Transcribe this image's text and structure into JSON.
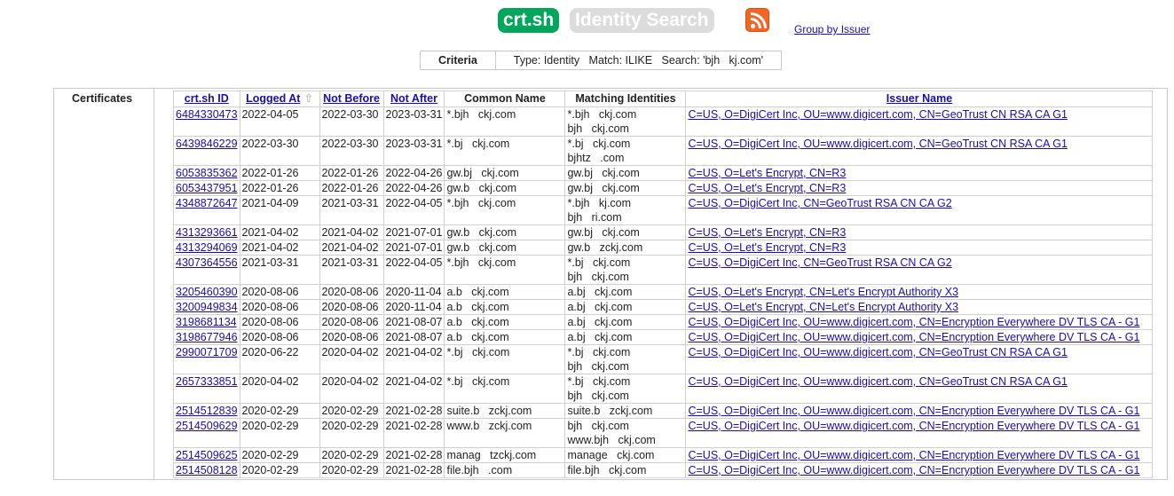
{
  "header": {
    "brand": "crt.sh",
    "title": "Identity Search",
    "group_link": "Group by Issuer"
  },
  "criteria": {
    "label": "Criteria",
    "text": "Type: Identity   Match: ILIKE   Search: 'bjh   kj.com'"
  },
  "section_label": "Certificates",
  "columns": {
    "id": "crt.sh ID",
    "logged": "Logged At",
    "sort_arrow": "⇧",
    "not_before": "Not Before",
    "not_after": "Not After",
    "common_name": "Common Name",
    "matching": "Matching Identities",
    "issuer": "Issuer Name"
  },
  "rows": [
    {
      "id": "6484330473",
      "logged": "2022-04-05",
      "not_before": "2022-03-30",
      "not_after": "2023-03-31",
      "cn": "*.bjh   ckj.com",
      "match": [
        "*.bjh   ckj.com",
        "bjh   ckj.com"
      ],
      "issuer": "C=US, O=DigiCert Inc, OU=www.digicert.com, CN=GeoTrust CN RSA CA G1"
    },
    {
      "id": "6439846229",
      "logged": "2022-03-30",
      "not_before": "2022-03-30",
      "not_after": "2023-03-31",
      "cn": "*.bj   ckj.com",
      "match": [
        "*.bj   ckj.com",
        "bjhtz   .com"
      ],
      "issuer": "C=US, O=DigiCert Inc, OU=www.digicert.com, CN=GeoTrust CN RSA CA G1"
    },
    {
      "id": "6053835362",
      "logged": "2022-01-26",
      "not_before": "2022-01-26",
      "not_after": "2022-04-26",
      "cn": "gw.bj   ckj.com",
      "match": [
        "gw.bj   ckj.com"
      ],
      "issuer": "C=US, O=Let's Encrypt, CN=R3"
    },
    {
      "id": "6053437951",
      "logged": "2022-01-26",
      "not_before": "2022-01-26",
      "not_after": "2022-04-26",
      "cn": "gw.b   ckj.com",
      "match": [
        "gw.bj   ckj.com"
      ],
      "issuer": "C=US, O=Let's Encrypt, CN=R3"
    },
    {
      "id": "4348872647",
      "logged": "2021-04-09",
      "not_before": "2021-03-31",
      "not_after": "2022-04-05",
      "cn": "*.bjh   ckj.com",
      "match": [
        "*.bjh   kj.com",
        "bjh   ri.com"
      ],
      "issuer": "C=US, O=DigiCert Inc, CN=GeoTrust RSA CN CA G2"
    },
    {
      "id": "4313293661",
      "logged": "2021-04-02",
      "not_before": "2021-04-02",
      "not_after": "2021-07-01",
      "cn": "gw.b   ckj.com",
      "match": [
        "gw.bj   ckj.com"
      ],
      "issuer": "C=US, O=Let's Encrypt, CN=R3"
    },
    {
      "id": "4313294069",
      "logged": "2021-04-02",
      "not_before": "2021-04-02",
      "not_after": "2021-07-01",
      "cn": "gw.b   ckj.com",
      "match": [
        "gw.b   zckj.com"
      ],
      "issuer": "C=US, O=Let's Encrypt, CN=R3"
    },
    {
      "id": "4307364556",
      "logged": "2021-03-31",
      "not_before": "2021-03-31",
      "not_after": "2022-04-05",
      "cn": "*.bjh   ckj.com",
      "match": [
        "*.bj   ckj.com",
        "bjh   ckj.com"
      ],
      "issuer": "C=US, O=DigiCert Inc, CN=GeoTrust RSA CN CA G2"
    },
    {
      "id": "3205460390",
      "logged": "2020-08-06",
      "not_before": "2020-08-06",
      "not_after": "2020-11-04",
      "cn": "a.b   ckj.com",
      "match": [
        "a.bj   ckj.com"
      ],
      "issuer": "C=US, O=Let's Encrypt, CN=Let's Encrypt Authority X3"
    },
    {
      "id": "3200949834",
      "logged": "2020-08-06",
      "not_before": "2020-08-06",
      "not_after": "2020-11-04",
      "cn": "a.b   ckj.com",
      "match": [
        "a.bj   ckj.com"
      ],
      "issuer": "C=US, O=Let's Encrypt, CN=Let's Encrypt Authority X3"
    },
    {
      "id": "3198681134",
      "logged": "2020-08-06",
      "not_before": "2020-08-06",
      "not_after": "2021-08-07",
      "cn": "a.b   ckj.com",
      "match": [
        "a.bj   ckj.com"
      ],
      "issuer": "C=US, O=DigiCert Inc, OU=www.digicert.com, CN=Encryption Everywhere DV TLS CA - G1"
    },
    {
      "id": "3198677946",
      "logged": "2020-08-06",
      "not_before": "2020-08-06",
      "not_after": "2021-08-07",
      "cn": "a.b   ckj.com",
      "match": [
        "a.bj   ckj.com"
      ],
      "issuer": "C=US, O=DigiCert Inc, OU=www.digicert.com, CN=Encryption Everywhere DV TLS CA - G1"
    },
    {
      "id": "2990071709",
      "logged": "2020-06-22",
      "not_before": "2020-04-02",
      "not_after": "2021-04-02",
      "cn": "*.bj   ckj.com",
      "match": [
        "*.bj   ckj.com",
        "bjh   ckj.com"
      ],
      "issuer": "C=US, O=DigiCert Inc, OU=www.digicert.com, CN=GeoTrust CN RSA CA G1"
    },
    {
      "id": "2657333851",
      "logged": "2020-04-02",
      "not_before": "2020-04-02",
      "not_after": "2021-04-02",
      "cn": "*.bj   ckj.com",
      "match": [
        "*.bj   ckj.com",
        "bjh   ckj.com"
      ],
      "issuer": "C=US, O=DigiCert Inc, OU=www.digicert.com, CN=GeoTrust CN RSA CA G1"
    },
    {
      "id": "2514512839",
      "logged": "2020-02-29",
      "not_before": "2020-02-29",
      "not_after": "2021-02-28",
      "cn": "suite.b   zckj.com",
      "match": [
        "suite.b   zckj.com"
      ],
      "issuer": "C=US, O=DigiCert Inc, OU=www.digicert.com, CN=Encryption Everywhere DV TLS CA - G1"
    },
    {
      "id": "2514509629",
      "logged": "2020-02-29",
      "not_before": "2020-02-29",
      "not_after": "2021-02-28",
      "cn": "www.b   zckj.com",
      "match": [
        "bjh   ckj.com",
        "www.bjh   ckj.com"
      ],
      "issuer": "C=US, O=DigiCert Inc, OU=www.digicert.com, CN=Encryption Everywhere DV TLS CA - G1"
    },
    {
      "id": "2514509625",
      "logged": "2020-02-29",
      "not_before": "2020-02-29",
      "not_after": "2021-02-28",
      "cn": "manag   tzckj.com",
      "match": [
        "manage   ckj.com"
      ],
      "issuer": "C=US, O=DigiCert Inc, OU=www.digicert.com, CN=Encryption Everywhere DV TLS CA - G1"
    },
    {
      "id": "2514508128",
      "logged": "2020-02-29",
      "not_before": "2020-02-29",
      "not_after": "2021-02-28",
      "cn": "file.bjh   .com",
      "match": [
        "file.bjh   ckj.com"
      ],
      "issuer": "C=US, O=DigiCert Inc, OU=www.digicert.com, CN=Encryption Everywhere DV TLS CA - G1"
    }
  ]
}
